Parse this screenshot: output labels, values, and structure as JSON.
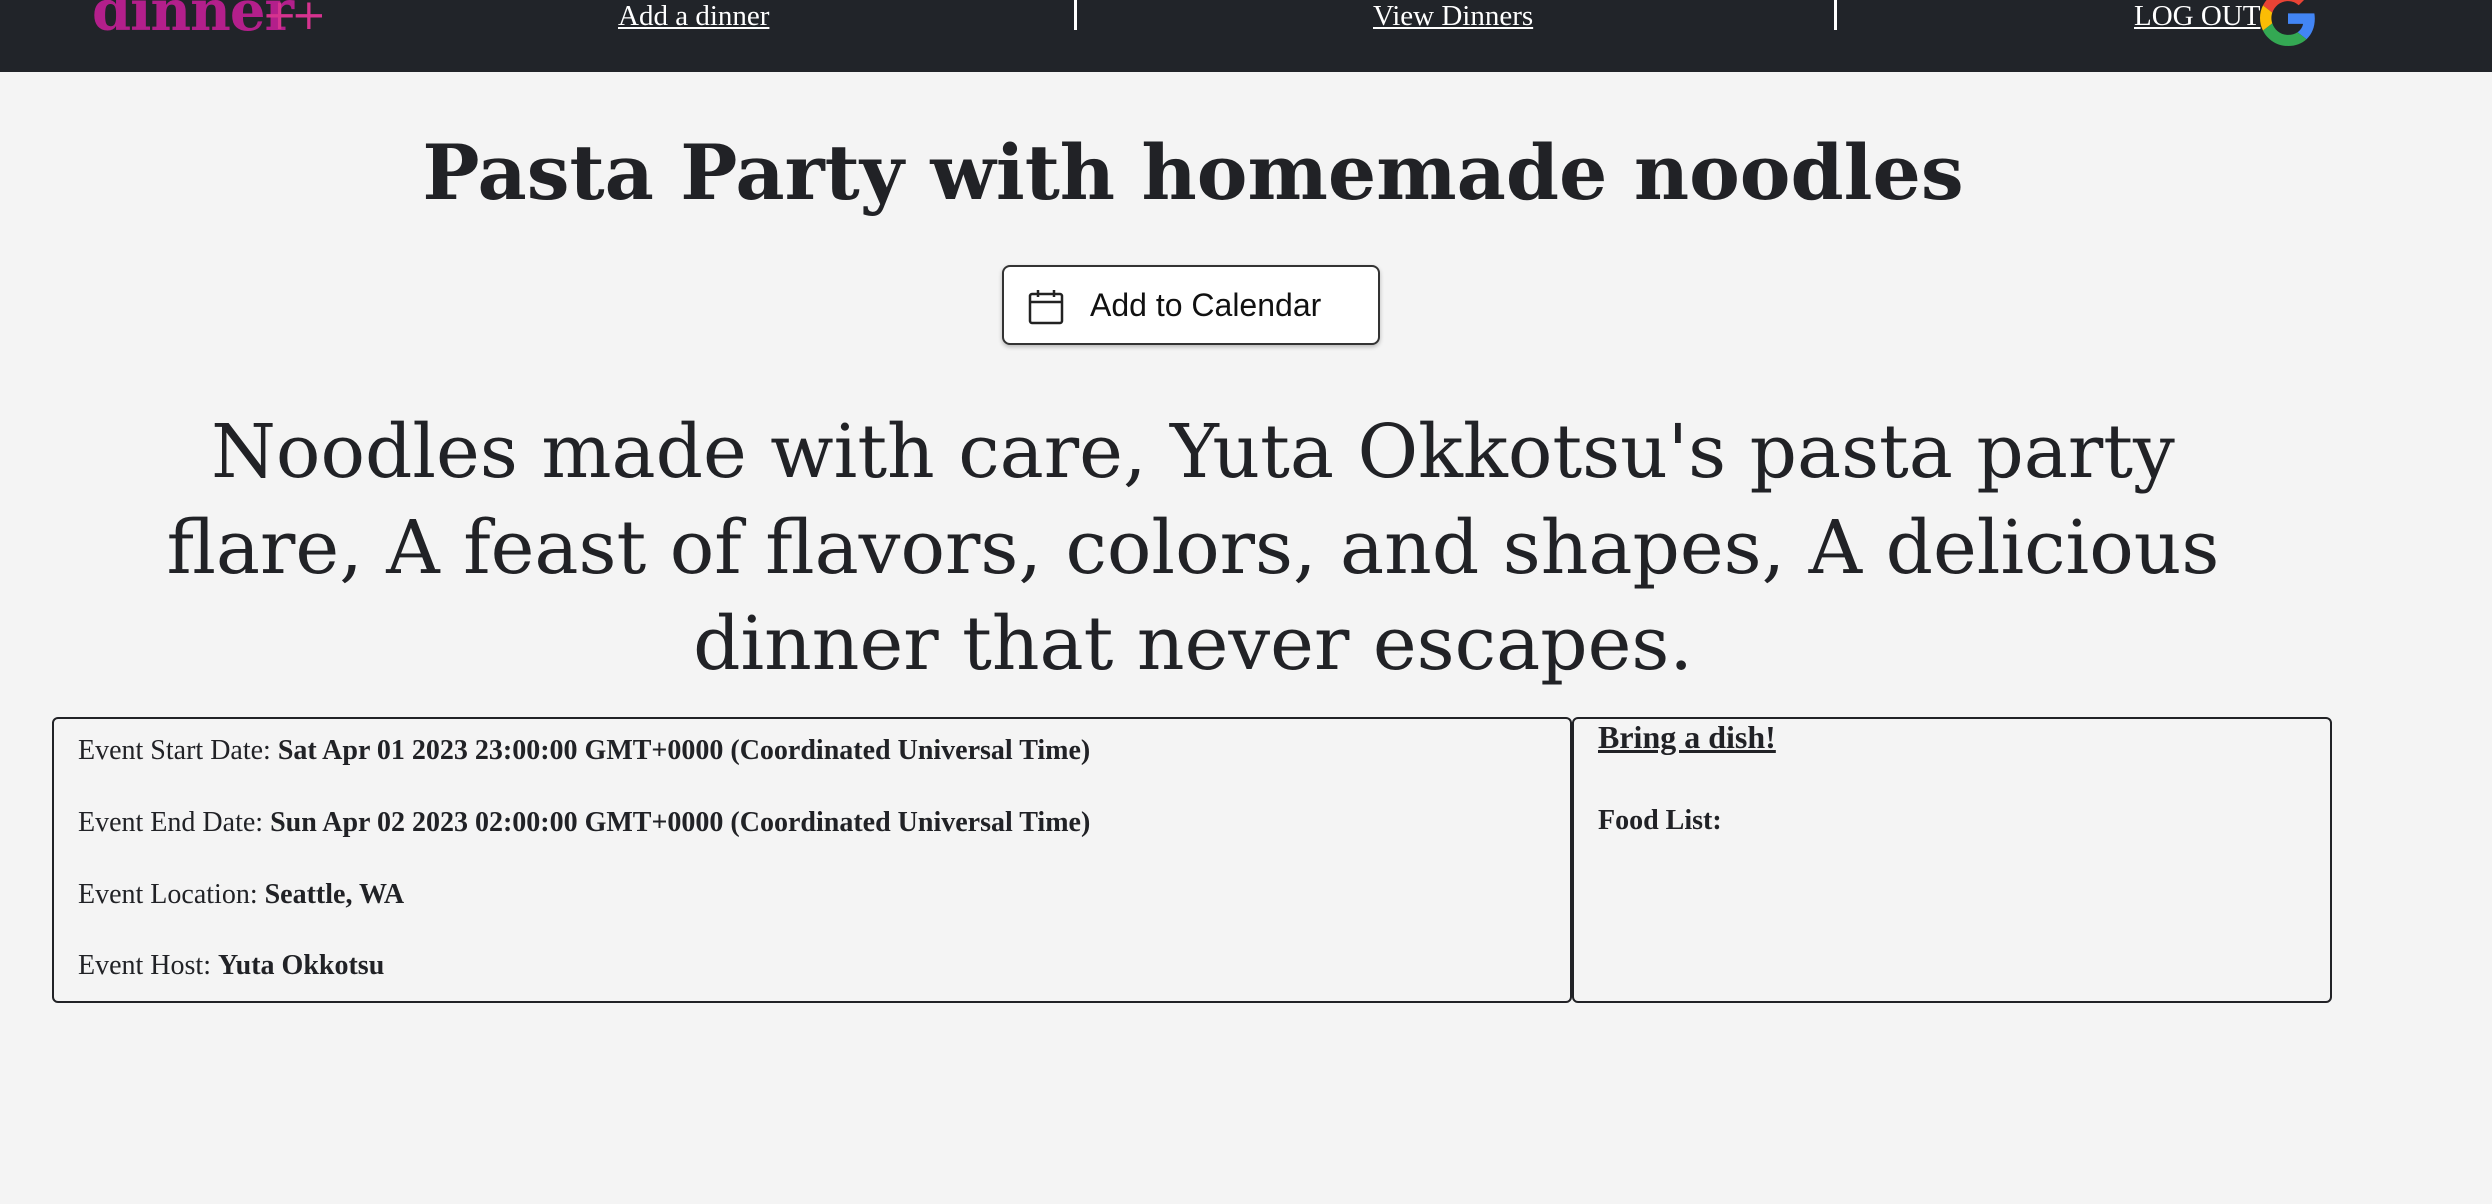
{
  "nav": {
    "brand_text": "dinner",
    "brand_suffix": "++",
    "add_dinner": "Add a dinner",
    "separator": "|",
    "view_dinners": "View Dinners",
    "logout": "LOG OUT",
    "logout_icon": "google-icon",
    "brand_color": "#b31f8b",
    "background_color": "#212429"
  },
  "event": {
    "title": "Pasta Party with homemade noodles",
    "calendar_button": "Add to Calendar",
    "calendar_icon": "calendar-icon",
    "description": "Noodles made with care, Yuta Okkotsu's pasta party flare, A feast of flavors, colors, and shapes, A delicious dinner that never escapes.",
    "details": {
      "start_label": "Event Start Date: ",
      "start_value": "Sat Apr 01 2023 23:00:00 GMT+0000 (Coordinated Universal Time)",
      "end_label": "Event End Date: ",
      "end_value": "Sun Apr 02 2023 02:00:00 GMT+0000 (Coordinated Universal Time)",
      "location_label": "Event Location: ",
      "location_value": "Seattle, WA",
      "host_label": "Event Host: ",
      "host_value": "Yuta Okkotsu"
    },
    "dishes": {
      "title": "Bring a dish!",
      "food_list_label": "Food List:",
      "items": []
    }
  }
}
